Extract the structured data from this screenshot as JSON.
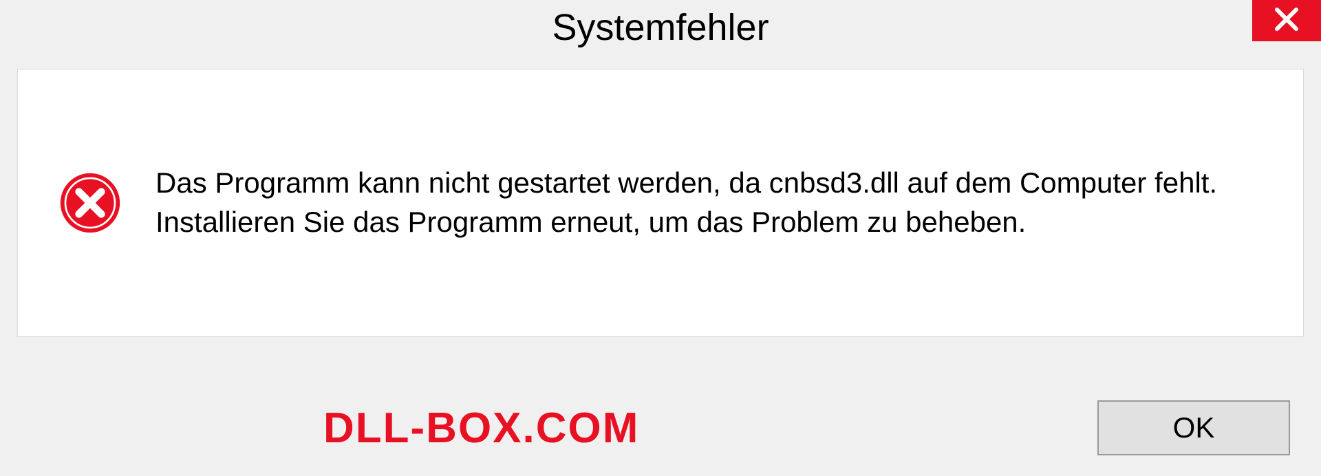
{
  "dialog": {
    "title": "Systemfehler",
    "message": "Das Programm kann nicht gestartet werden, da cnbsd3.dll auf dem Computer fehlt. Installieren Sie das Programm erneut, um das Problem zu beheben.",
    "ok_label": "OK",
    "watermark": "DLL-BOX.COM"
  },
  "colors": {
    "error_red": "#e81123",
    "close_red": "#e81123"
  }
}
